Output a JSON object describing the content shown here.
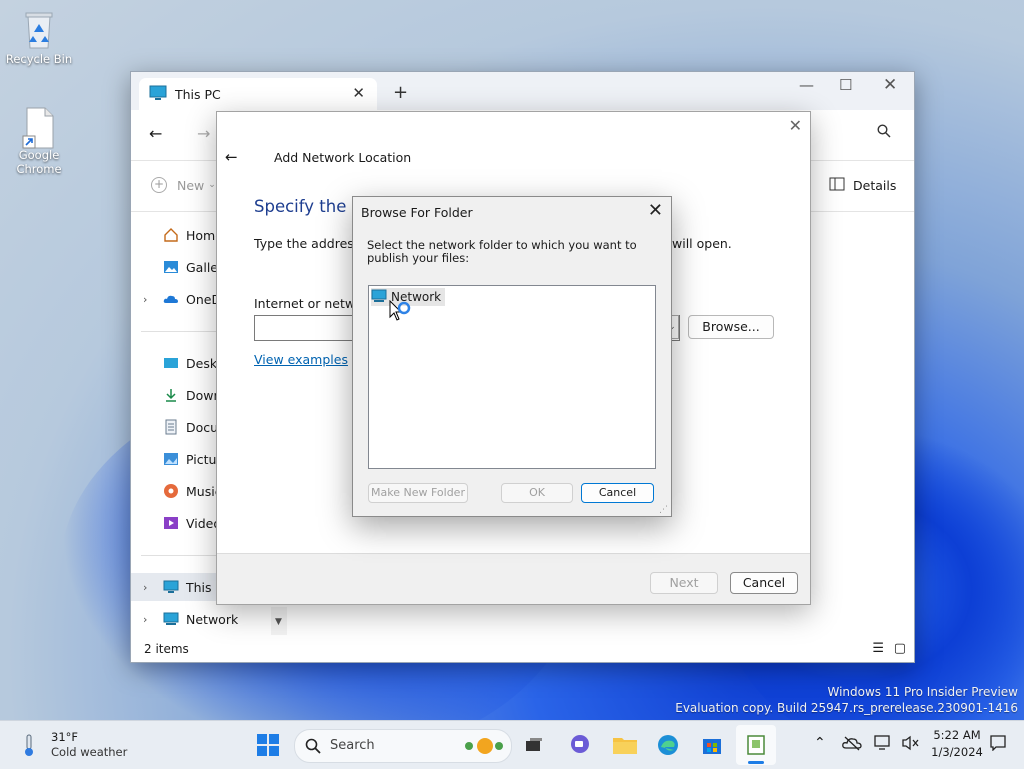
{
  "desktop": {
    "icons": [
      {
        "label": "Recycle Bin",
        "icon": "recycle-bin-icon"
      },
      {
        "label": "Google Chrome",
        "icon": "file-shortcut-icon"
      }
    ],
    "watermark": {
      "line1": "Windows 11 Pro Insider Preview",
      "line2": "Evaluation copy. Build 25947.rs_prerelease.230901-1416"
    }
  },
  "explorer": {
    "tab_title": "This PC",
    "new_label": "New",
    "details_label": "Details",
    "sidebar": [
      {
        "label": "Home",
        "icon": "home-icon"
      },
      {
        "label": "Gallery",
        "icon": "gallery-icon"
      },
      {
        "label": "OneDrive",
        "icon": "onedrive-icon"
      },
      {
        "label": "Desktop",
        "icon": "desktop-folder-icon"
      },
      {
        "label": "Downloads",
        "icon": "downloads-icon"
      },
      {
        "label": "Documents",
        "icon": "documents-icon"
      },
      {
        "label": "Pictures",
        "icon": "pictures-icon"
      },
      {
        "label": "Music",
        "icon": "music-icon"
      },
      {
        "label": "Videos",
        "icon": "videos-icon"
      },
      {
        "label": "This PC",
        "icon": "this-pc-icon"
      },
      {
        "label": "Network",
        "icon": "network-icon"
      }
    ],
    "status": "2 items"
  },
  "wizard": {
    "title": "Add Network Location",
    "heading": "Specify the loc",
    "description": "Type the address o",
    "description_tail": "will open.",
    "address_label": "Internet or network",
    "address_value": "",
    "browse_label": "Browse...",
    "view_examples": "View examples",
    "next_label": "Next",
    "cancel_label": "Cancel"
  },
  "browse_dialog": {
    "title": "Browse For Folder",
    "instruction": "Select the network folder to which you want to publish your files:",
    "tree_selected": "Network",
    "make_new_folder_label": "Make New Folder",
    "ok_label": "OK",
    "cancel_label": "Cancel"
  },
  "taskbar": {
    "weather_temp": "31°F",
    "weather_desc": "Cold weather",
    "search_placeholder": "Search",
    "time": "5:22 AM",
    "date": "1/3/2024"
  },
  "colors": {
    "accent": "#0063b1",
    "wizard_heading": "#1e3e90"
  }
}
